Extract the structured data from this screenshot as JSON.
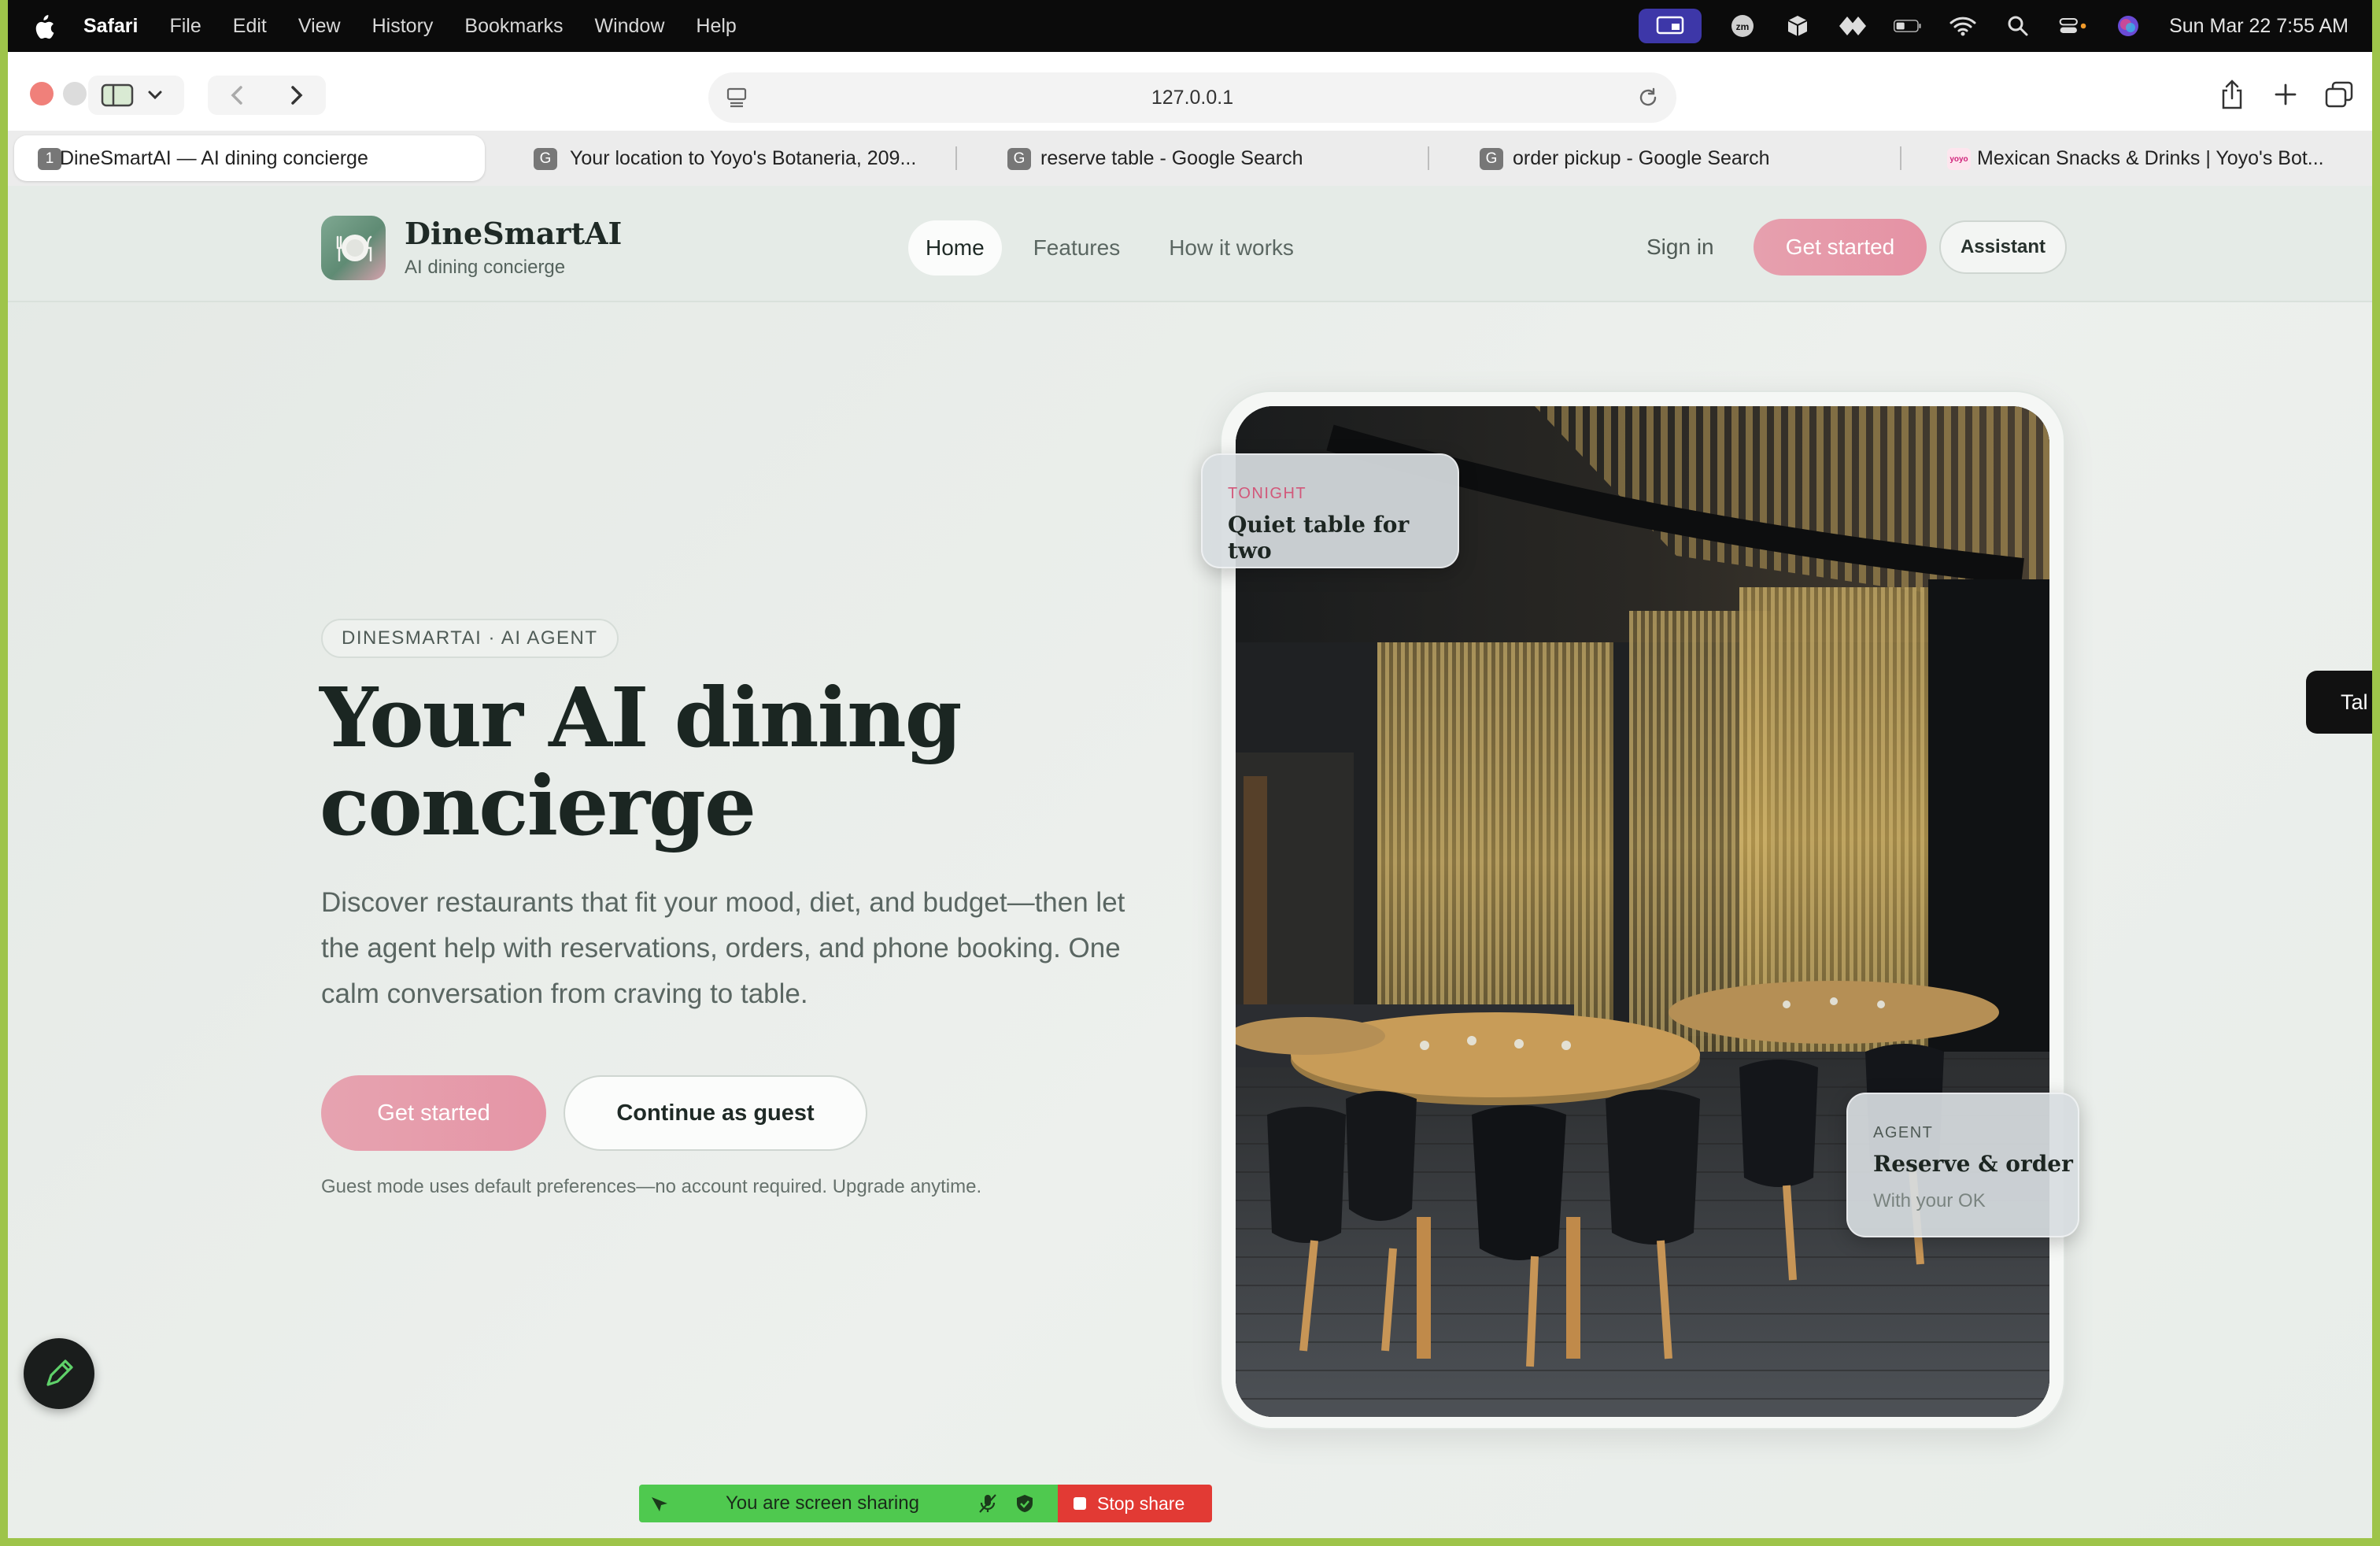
{
  "menubar": {
    "app": "Safari",
    "menus": [
      "File",
      "Edit",
      "View",
      "History",
      "Bookmarks",
      "Window",
      "Help"
    ],
    "clock": "Sun Mar 22  7:55 AM",
    "zoom_badge": "zm"
  },
  "browser": {
    "url": "127.0.0.1",
    "tabs": [
      {
        "favicon": "1",
        "label": "DineSmartAI — AI dining concierge"
      },
      {
        "favicon": "G",
        "label": "Your location to Yoyo's Botaneria, 209..."
      },
      {
        "favicon": "G",
        "label": "reserve table - Google Search"
      },
      {
        "favicon": "G",
        "label": "order pickup - Google Search"
      },
      {
        "favicon": "yoyo",
        "label": "Mexican Snacks & Drinks | Yoyo's Bot..."
      }
    ]
  },
  "site": {
    "brand": "DineSmartAI",
    "tagline": "AI dining concierge",
    "nav": [
      "Home",
      "Features",
      "How it works"
    ],
    "sign_in": "Sign in",
    "get_started": "Get started",
    "assistant": "Assistant"
  },
  "hero": {
    "eyebrow": "DINESMARTAI · AI AGENT",
    "headline_line1": "Your AI dining",
    "headline_line2": "concierge",
    "lead": "Discover restaurants that fit your mood, diet, and budget—then let the agent help with reservations, orders, and phone booking. One calm conversation from craving to table.",
    "primary_cta": "Get started",
    "secondary_cta": "Continue as guest",
    "note": "Guest mode uses default preferences—no account required. Upgrade anytime."
  },
  "cards": {
    "tonight": {
      "kicker": "TONIGHT",
      "title": "Quiet table for two"
    },
    "agent": {
      "kicker": "AGENT",
      "title": "Reserve & order",
      "sub": "With your OK"
    }
  },
  "side_tab": "Tal",
  "screen_share": {
    "status": "You are screen sharing",
    "stop": "Stop share"
  },
  "colors": {
    "accent": "#e595a6",
    "brand_green": "#6f9a83",
    "share_green": "#4fc94f",
    "share_red": "#e23a34"
  }
}
